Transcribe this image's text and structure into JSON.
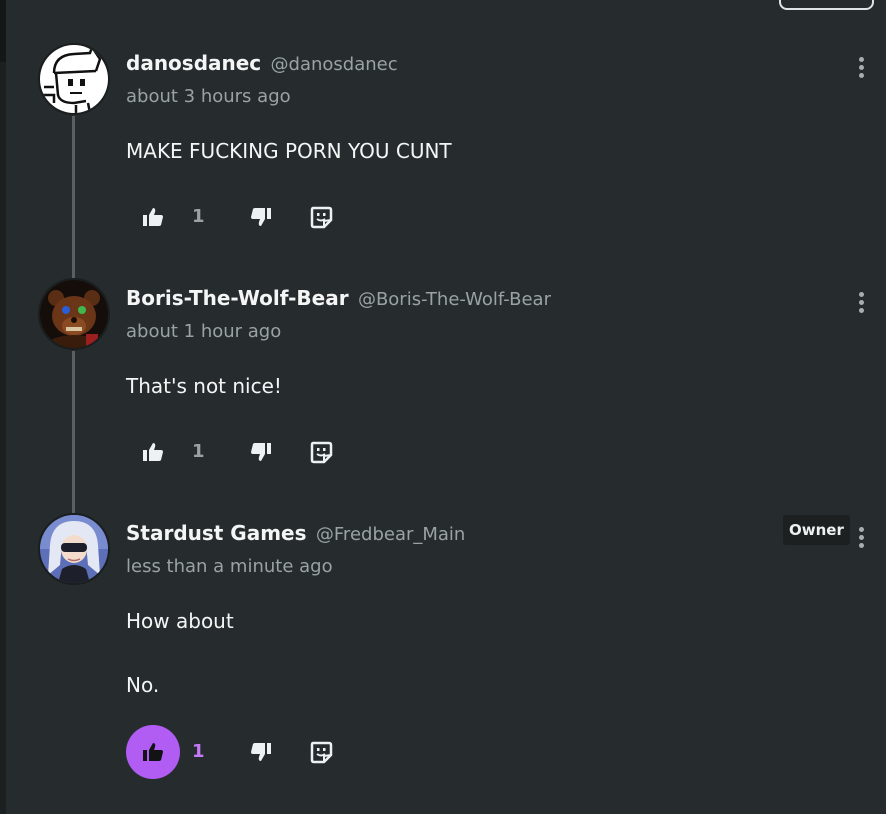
{
  "colors": {
    "background": "#262c2d",
    "accent": "#b15cf2",
    "muted_text": "#9aa2a3",
    "thread_line": "#5a6062"
  },
  "comments": [
    {
      "display_name": "danosdanec",
      "handle": "@danosdanec",
      "timestamp": "about 3 hours ago",
      "body": [
        "MAKE FUCKING PORN YOU CUNT"
      ],
      "like_count": "1",
      "liked": false,
      "badge": "",
      "avatar": "sketch-avatar"
    },
    {
      "display_name": "Boris-The-Wolf-Bear",
      "handle": "@Boris-The-Wolf-Bear",
      "timestamp": "about 1 hour ago",
      "body": [
        "That's not nice!"
      ],
      "like_count": "1",
      "liked": false,
      "badge": "",
      "avatar": "bear-avatar"
    },
    {
      "display_name": "Stardust Games",
      "handle": "@Fredbear_Main",
      "timestamp": "less than a minute ago",
      "body": [
        "How about",
        "No."
      ],
      "like_count": "1",
      "liked": true,
      "badge": "Owner",
      "avatar": "anime-avatar"
    }
  ],
  "icons": {
    "like": "thumbs-up-icon",
    "dislike": "thumbs-down-icon",
    "reply": "reply-icon",
    "menu": "more-vertical-icon"
  }
}
